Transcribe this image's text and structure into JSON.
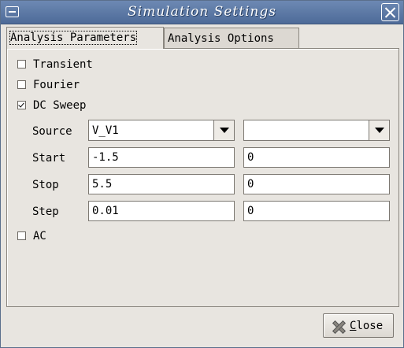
{
  "window": {
    "title": "Simulation Settings"
  },
  "tabs": [
    {
      "label": "Analysis Parameters",
      "active": true
    },
    {
      "label": "Analysis Options",
      "active": false
    }
  ],
  "analyses": {
    "transient": {
      "label": "Transient",
      "checked": false
    },
    "fourier": {
      "label": "Fourier",
      "checked": false
    },
    "dc_sweep": {
      "label": "DC Sweep",
      "checked": true
    },
    "ac": {
      "label": "AC",
      "checked": false
    }
  },
  "dc_sweep": {
    "source_label": "Source",
    "source_primary": "V_V1",
    "source_secondary": "",
    "start_label": "Start",
    "start_primary": "-1.5",
    "start_secondary": "0",
    "stop_label": "Stop",
    "stop_primary": "5.5",
    "stop_secondary": "0",
    "step_label": "Step",
    "step_primary": "0.01",
    "step_secondary": "0"
  },
  "footer": {
    "close_mnemonic": "C",
    "close_rest": "lose"
  },
  "icons": {
    "window_menu": "window-menu-icon",
    "window_close": "close-icon",
    "close_button": "cross-icon",
    "dropdown": "chevron-down-icon"
  },
  "colors": {
    "titlebar": "#5b79a8",
    "background": "#e8e5e0",
    "field": "#ffffff"
  }
}
